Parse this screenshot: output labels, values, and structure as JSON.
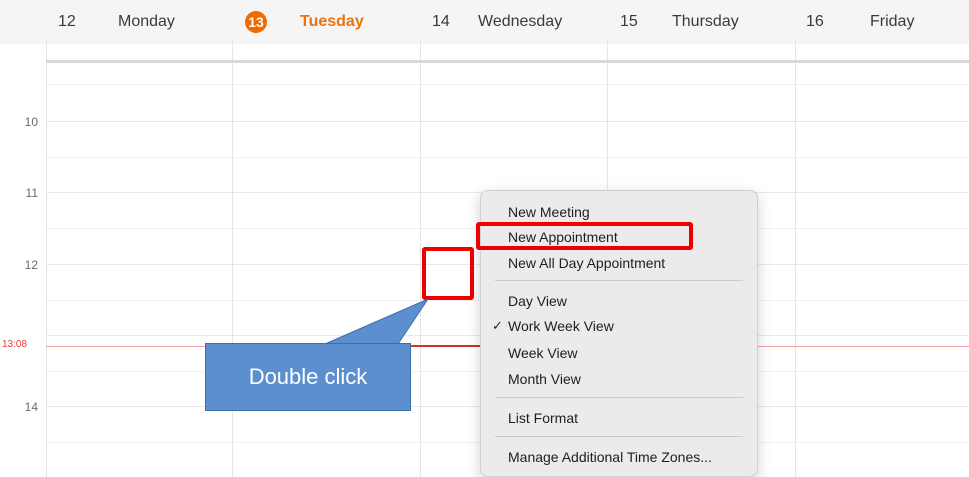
{
  "days": [
    {
      "num": "12",
      "name": "Monday",
      "today": false
    },
    {
      "num": "13",
      "name": "Tuesday",
      "today": true
    },
    {
      "num": "14",
      "name": "Wednesday",
      "today": false
    },
    {
      "num": "15",
      "name": "Thursday",
      "today": false
    },
    {
      "num": "16",
      "name": "Friday",
      "today": false
    }
  ],
  "hours": [
    "10",
    "11",
    "12",
    "14"
  ],
  "current_time": "13:08",
  "context_menu": {
    "items": [
      {
        "label": "New Meeting"
      },
      {
        "label": "New Appointment",
        "highlighted": true
      },
      {
        "label": "New All Day Appointment"
      },
      {
        "label": "Day View"
      },
      {
        "label": "Work Week View",
        "checked": true
      },
      {
        "label": "Week View"
      },
      {
        "label": "Month View"
      },
      {
        "label": "List Format"
      },
      {
        "label": "Manage Additional Time Zones..."
      }
    ],
    "check_glyph": "✓"
  },
  "callout": {
    "text": "Double click"
  },
  "colors": {
    "today_badge": "#f06a00",
    "today_text": "#e8740c",
    "now_line": "#e23d3d",
    "highlight": "#ee0000",
    "callout_fill": "#5b8fcf"
  }
}
